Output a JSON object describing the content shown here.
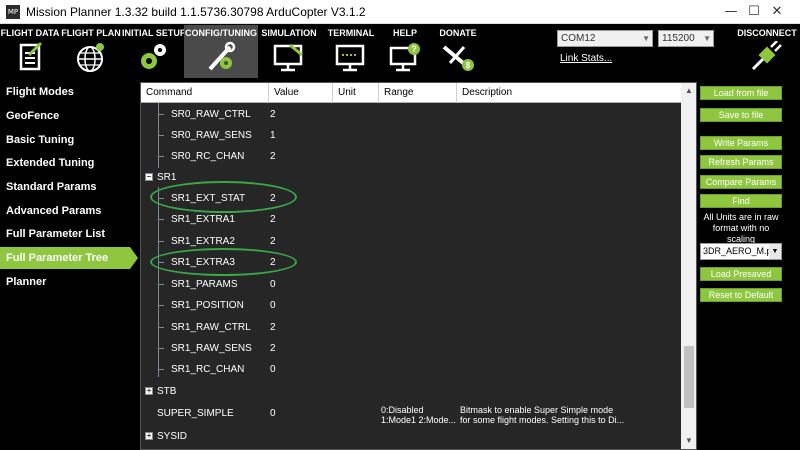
{
  "window": {
    "logo_text": "MP",
    "title": "Mission Planner 1.3.32 build 1.1.5736.30798 ArduCopter V3.1.2",
    "minimize": "—",
    "maximize": "☐",
    "close": "✕"
  },
  "toolbar": {
    "buttons": [
      {
        "label": "FLIGHT DATA"
      },
      {
        "label": "FLIGHT PLAN"
      },
      {
        "label": "INITIAL SETUP"
      },
      {
        "label": "CONFIG/TUNING"
      },
      {
        "label": "SIMULATION"
      },
      {
        "label": "TERMINAL"
      },
      {
        "label": "HELP"
      },
      {
        "label": "DONATE"
      }
    ],
    "com_port": "COM12",
    "baud_rate": "115200",
    "link_stats": "Link Stats...",
    "connect_label": "DISCONNECT"
  },
  "sidebar": {
    "items": [
      {
        "label": "Flight Modes"
      },
      {
        "label": "GeoFence"
      },
      {
        "label": "Basic Tuning"
      },
      {
        "label": "Extended Tuning"
      },
      {
        "label": "Standard Params"
      },
      {
        "label": "Advanced Params"
      },
      {
        "label": "Full Parameter List"
      },
      {
        "label": "Full Parameter Tree"
      },
      {
        "label": "Planner"
      }
    ],
    "active": "Full Parameter Tree"
  },
  "grid": {
    "columns": [
      "Command",
      "Value",
      "Unit",
      "Range",
      "Description"
    ],
    "rows": [
      {
        "command": "SR0_RAW_CTRL",
        "value": "2"
      },
      {
        "command": "SR0_RAW_SENS",
        "value": "1"
      },
      {
        "command": "SR0_RC_CHAN",
        "value": "2"
      },
      {
        "command": "SR1",
        "value": "",
        "group": true,
        "expander": "−"
      },
      {
        "command": "SR1_EXT_STAT",
        "value": "2",
        "highlighted": true
      },
      {
        "command": "SR1_EXTRA1",
        "value": "2"
      },
      {
        "command": "SR1_EXTRA2",
        "value": "2"
      },
      {
        "command": "SR1_EXTRA3",
        "value": "2",
        "highlighted": true
      },
      {
        "command": "SR1_PARAMS",
        "value": "0"
      },
      {
        "command": "SR1_POSITION",
        "value": "0"
      },
      {
        "command": "SR1_RAW_CTRL",
        "value": "2"
      },
      {
        "command": "SR1_RAW_SENS",
        "value": "2"
      },
      {
        "command": "SR1_RC_CHAN",
        "value": "0"
      },
      {
        "command": "STB",
        "value": "",
        "group": true,
        "expander": "+"
      },
      {
        "command": "SUPER_SIMPLE",
        "value": "0",
        "range_line1": "0:Disabled",
        "range_line2": "1:Mode1  2:Mode...",
        "desc_line1": "Bitmask to enable Super Simple mode",
        "desc_line2": "for some flight modes. Setting this to Di..."
      },
      {
        "command": "SYSID",
        "value": "",
        "group": true,
        "expander": "+"
      }
    ]
  },
  "right_panel": {
    "load_from_file": "Load from file",
    "save_to_file": "Save to file",
    "write_params": "Write Params",
    "refresh_params": "Refresh Params",
    "compare_params": "Compare Params",
    "find": "Find",
    "units_note": "All Units are in raw format with no scaling",
    "param_file": "3DR_AERO_M.p",
    "load_presaved": "Load Presaved",
    "reset_to_default": "Reset to Default"
  },
  "colors": {
    "accent_green": "#8ec63f",
    "highlight_oval": "#3aa64a",
    "grid_bg": "#262626"
  }
}
